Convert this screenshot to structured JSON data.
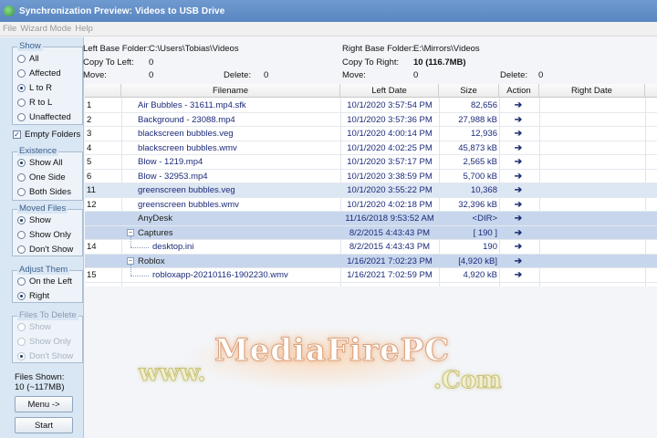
{
  "window": {
    "title": "Synchronization Preview: Videos to USB Drive"
  },
  "menu": [
    "File",
    "Wizard Mode",
    "Help"
  ],
  "left": {
    "show": {
      "title": "Show",
      "options": [
        "All",
        "Affected",
        "L to R",
        "R to L",
        "Unaffected"
      ],
      "selected": 2
    },
    "empty_folders": {
      "label": "Empty Folders",
      "checked": true
    },
    "existence": {
      "title": "Existence",
      "options": [
        "Show All",
        "One Side",
        "Both Sides"
      ],
      "selected": 0
    },
    "moved": {
      "title": "Moved Files",
      "options": [
        "Show",
        "Show Only",
        "Don't Show"
      ],
      "selected": 0
    },
    "adjust": {
      "title": "Adjust Them",
      "options": [
        "On the Left",
        "Right"
      ],
      "selected": 1
    },
    "delete": {
      "title": "Files To Delete",
      "options": [
        "Show",
        "Show Only",
        "Don't Show"
      ],
      "selected": 2
    },
    "files_shown_label": "Files Shown:",
    "files_shown_value": "10 (~117MB)",
    "menu_button": "Menu ->",
    "start_button": "Start"
  },
  "info": {
    "left_base_label": "Left Base Folder:",
    "left_base_value": "C:\\Users\\Tobias\\Videos",
    "copy_left_label": "Copy To Left:",
    "copy_left_value": "0",
    "move_left_label": "Move:",
    "move_left_value": "0",
    "delete_left_label": "Delete:",
    "delete_left_value": "0",
    "right_base_label": "Right Base Folder:",
    "right_base_value": "E:\\Mirrors\\Videos",
    "copy_right_label": "Copy To Right:",
    "copy_right_value": "10 (116.7MB)",
    "move_right_label": "Move:",
    "move_right_value": "0",
    "delete_right_label": "Delete:",
    "delete_right_value": "0"
  },
  "table": {
    "columns": [
      "Filename",
      "Left Date",
      "Size",
      "Action",
      "Right Date"
    ],
    "rows": [
      {
        "num": "1",
        "name": "Air Bubbles - 31611.mp4.sfk",
        "date": "10/1/2020 3:57:54 PM",
        "size": "82,656",
        "action": "➔"
      },
      {
        "num": "2",
        "name": "Background - 23088.mp4",
        "date": "10/1/2020 3:57:36 PM",
        "size": "27,988 kB",
        "action": "➔"
      },
      {
        "num": "3",
        "name": "blackscreen bubbles.veg",
        "date": "10/1/2020 4:00:14 PM",
        "size": "12,936",
        "action": "➔"
      },
      {
        "num": "4",
        "name": "blackscreen bubbles.wmv",
        "date": "10/1/2020 4:02:25 PM",
        "size": "45,873 kB",
        "action": "➔"
      },
      {
        "num": "5",
        "name": "Blow - 1219.mp4",
        "date": "10/1/2020 3:57:17 PM",
        "size": "2,565 kB",
        "action": "➔"
      },
      {
        "num": "6",
        "name": "Blow - 32953.mp4",
        "date": "10/1/2020 3:38:59 PM",
        "size": "5,700 kB",
        "action": "➔"
      },
      {
        "num": "11",
        "name": "greenscreen bubbles.veg",
        "date": "10/1/2020 3:55:22 PM",
        "size": "10,368",
        "action": "➔"
      },
      {
        "num": "12",
        "name": "greenscreen bubbles.wmv",
        "date": "10/1/2020 4:02:18 PM",
        "size": "32,396 kB",
        "action": "➔"
      },
      {
        "num": "",
        "name": "AnyDesk",
        "date": "11/16/2018 9:53:52 AM",
        "size": "<DIR>",
        "action": "➔"
      },
      {
        "num": "",
        "name": "Captures",
        "date": "8/2/2015 4:43:43 PM",
        "size": "[ 190 ]",
        "action": "➔"
      },
      {
        "num": "14",
        "name": "desktop.ini",
        "date": "8/2/2015 4:43:43 PM",
        "size": "190",
        "action": "➔"
      },
      {
        "num": "",
        "name": "Roblox",
        "date": "1/16/2021 7:02:23 PM",
        "size": "[4,920 kB]",
        "action": "➔"
      },
      {
        "num": "15",
        "name": "robloxapp-20210116-1902230.wmv",
        "date": "1/16/2021 7:02:59 PM",
        "size": "4,920 kB",
        "action": "➔"
      }
    ]
  },
  "watermark": {
    "line1": "MediaFirePC",
    "line2": "www.",
    "line3": ".Com"
  }
}
